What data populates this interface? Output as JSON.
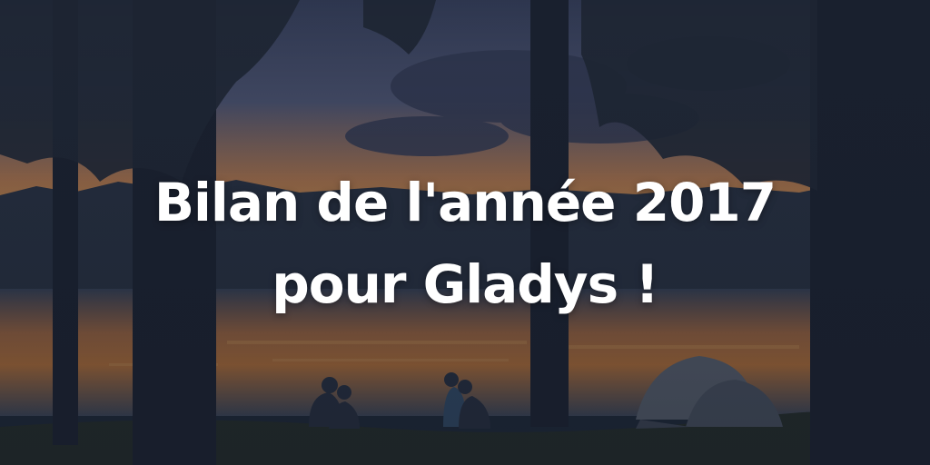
{
  "headline": {
    "line1": "Bilan de l'année 2017",
    "line2": "pour Gladys !"
  },
  "colors": {
    "sky_top": "#4a5577",
    "sky_glow": "#f0a552",
    "water_glow": "#e88a3a",
    "forest": "#2a3345",
    "trunk": "#1b2230",
    "tent": "#6a7380",
    "text": "#ffffff"
  }
}
